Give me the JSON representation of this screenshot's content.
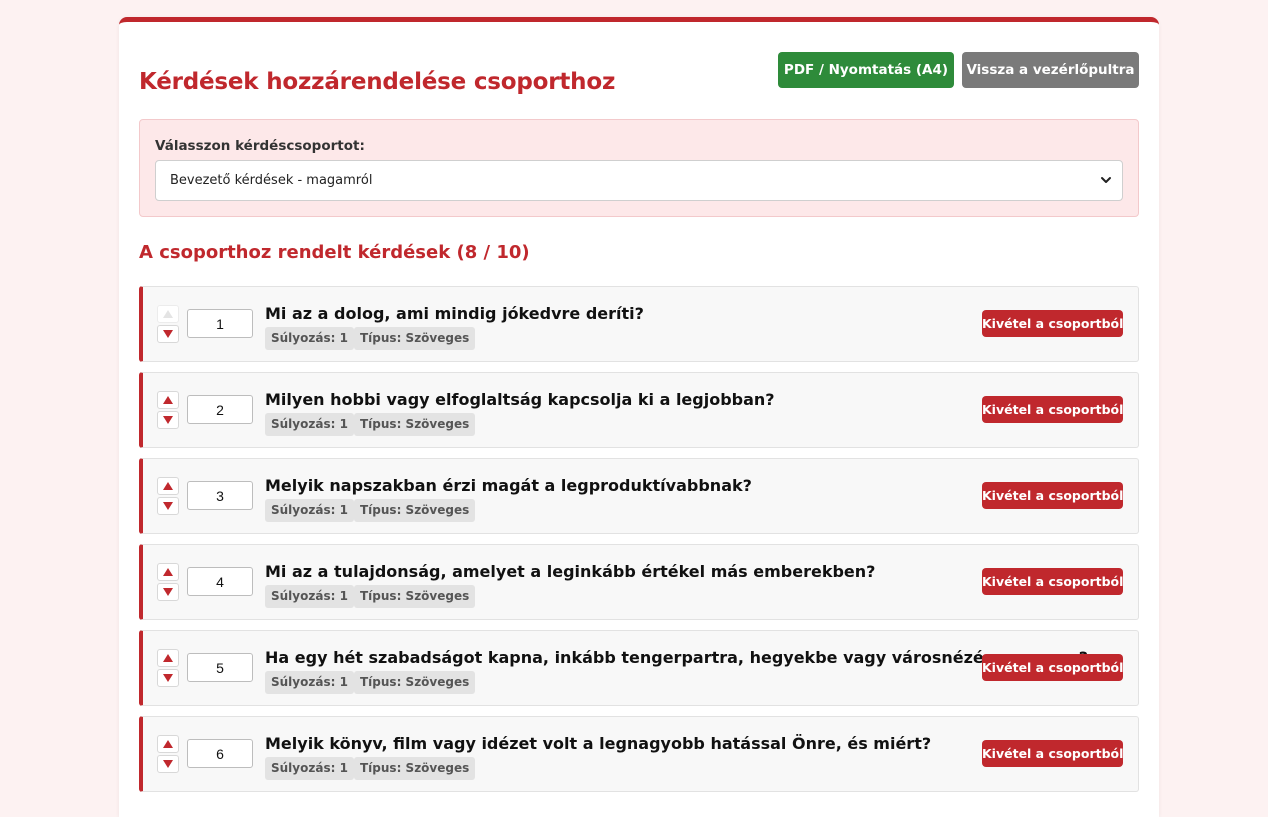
{
  "header": {
    "title": "Kérdések hozzárendelése csoporthoz",
    "pdf_button": "PDF / Nyomtatás (A4)",
    "back_button": "Vissza a vezérlőpultra"
  },
  "group_select": {
    "label": "Válasszon kérdéscsoportot:",
    "selected": "Bevezető kérdések - magamról"
  },
  "assigned": {
    "title": "A csoporthoz rendelt kérdések (8 / 10)",
    "questions": [
      {
        "order": "1",
        "text": "Mi az a dolog, ami mindig jókedvre deríti?",
        "weight": "Súlyozás: 1",
        "type": "Típus: Szöveges",
        "remove": "Kivétel a csoportból",
        "can_move_up": false
      },
      {
        "order": "2",
        "text": "Milyen hobbi vagy elfoglaltság kapcsolja ki a legjobban?",
        "weight": "Súlyozás: 1",
        "type": "Típus: Szöveges",
        "remove": "Kivétel a csoportból",
        "can_move_up": true
      },
      {
        "order": "3",
        "text": "Melyik napszakban érzi magát a legproduktívabbnak?",
        "weight": "Súlyozás: 1",
        "type": "Típus: Szöveges",
        "remove": "Kivétel a csoportból",
        "can_move_up": true
      },
      {
        "order": "4",
        "text": "Mi az a tulajdonság, amelyet a leginkább értékel más emberekben?",
        "weight": "Súlyozás: 1",
        "type": "Típus: Szöveges",
        "remove": "Kivétel a csoportból",
        "can_move_up": true
      },
      {
        "order": "5",
        "text": "Ha egy hét szabadságot kapna, inkább tengerpartra, hegyekbe vagy városnézésre menne?",
        "weight": "Súlyozás: 1",
        "type": "Típus: Szöveges",
        "remove": "Kivétel a csoportból",
        "can_move_up": true
      },
      {
        "order": "6",
        "text": "Melyik könyv, film vagy idézet volt a legnagyobb hatással Önre, és miért?",
        "weight": "Súlyozás: 1",
        "type": "Típus: Szöveges",
        "remove": "Kivétel a csoportból",
        "can_move_up": true
      }
    ]
  },
  "colors": {
    "accent": "#c0282d",
    "pdf_button": "#2e8b3a",
    "back_button": "#7a7a7a",
    "page_background": "#fdf2f2"
  },
  "icons": {
    "move_up": "triangle-up-icon",
    "move_down": "triangle-down-icon",
    "dropdown": "chevron-down-icon"
  }
}
